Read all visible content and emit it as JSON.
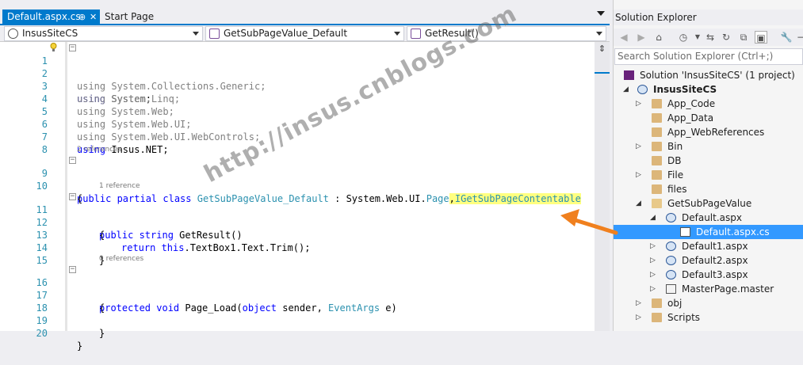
{
  "tabs": {
    "active": {
      "label": "Default.aspx.cs",
      "pin": "⊕",
      "close": "✕"
    },
    "inactive": {
      "label": "Start Page"
    }
  },
  "navbar": {
    "project": "InsusSiteCS",
    "class": "GetSubPageValue_Default",
    "member": "GetResult()"
  },
  "code": {
    "lines": [
      {
        "n": "1",
        "text": "using System;"
      },
      {
        "n": "2",
        "text": "using System.Collections.Generic;"
      },
      {
        "n": "3",
        "text": "using System.Linq;"
      },
      {
        "n": "4",
        "text": "using System.Web;"
      },
      {
        "n": "5",
        "text": "using System.Web.UI;"
      },
      {
        "n": "6",
        "text": "using System.Web.UI.WebControls;"
      },
      {
        "n": "7",
        "text": "using Insus.NET;"
      },
      {
        "n": "8",
        "text": ""
      },
      {
        "n": "9",
        "text": "public partial class GetSubPageValue_Default : System.Web.UI.Page,IGetSubPageContentable"
      },
      {
        "n": "10",
        "text": "{"
      },
      {
        "n": "11",
        "text": "public string GetResult()"
      },
      {
        "n": "12",
        "text": "{"
      },
      {
        "n": "13",
        "text": "return this.TextBox1.Text.Trim();"
      },
      {
        "n": "14",
        "text": "}"
      },
      {
        "n": "15",
        "text": ""
      },
      {
        "n": "16",
        "text": "protected void Page_Load(object sender, EventArgs e)"
      },
      {
        "n": "17",
        "text": "{"
      },
      {
        "n": "18",
        "text": ""
      },
      {
        "n": "19",
        "text": "}"
      },
      {
        "n": "20",
        "text": "}"
      }
    ],
    "refs": {
      "class": "2 references",
      "getresult": "1 reference",
      "pageload": "0 references"
    }
  },
  "watermark": "http://insus.cnblogs.com",
  "solution_explorer": {
    "title": "Solution Explorer",
    "search_placeholder": "Search Solution Explorer (Ctrl+;)",
    "tree": [
      {
        "label": "Solution 'InsusSiteCS' (1 project)",
        "icon": "solution-icon"
      },
      {
        "label": "InsusSiteCS",
        "icon": "website-icon"
      },
      {
        "label": "App_Code",
        "icon": "folder-icon"
      },
      {
        "label": "App_Data",
        "icon": "folder-icon"
      },
      {
        "label": "App_WebReferences",
        "icon": "folder-icon"
      },
      {
        "label": "Bin",
        "icon": "folder-icon"
      },
      {
        "label": "DB",
        "icon": "folder-icon"
      },
      {
        "label": "File",
        "icon": "folder-icon"
      },
      {
        "label": "files",
        "icon": "folder-icon"
      },
      {
        "label": "GetSubPageValue",
        "icon": "folder-icon"
      },
      {
        "label": "Default.aspx",
        "icon": "aspx-icon"
      },
      {
        "label": "Default.aspx.cs",
        "icon": "cs-file-icon"
      },
      {
        "label": "Default1.aspx",
        "icon": "aspx-icon"
      },
      {
        "label": "Default2.aspx",
        "icon": "aspx-icon"
      },
      {
        "label": "Default3.aspx",
        "icon": "aspx-icon"
      },
      {
        "label": "MasterPage.master",
        "icon": "master-file-icon"
      },
      {
        "label": "obj",
        "icon": "folder-icon"
      },
      {
        "label": "Scripts",
        "icon": "folder-icon"
      }
    ]
  },
  "colors": {
    "accent": "#007acc",
    "selection": "#3399ff",
    "keyword": "#0000ff",
    "type": "#2b91af",
    "arrow": "#f0801e",
    "highlight": "#ffff80"
  }
}
